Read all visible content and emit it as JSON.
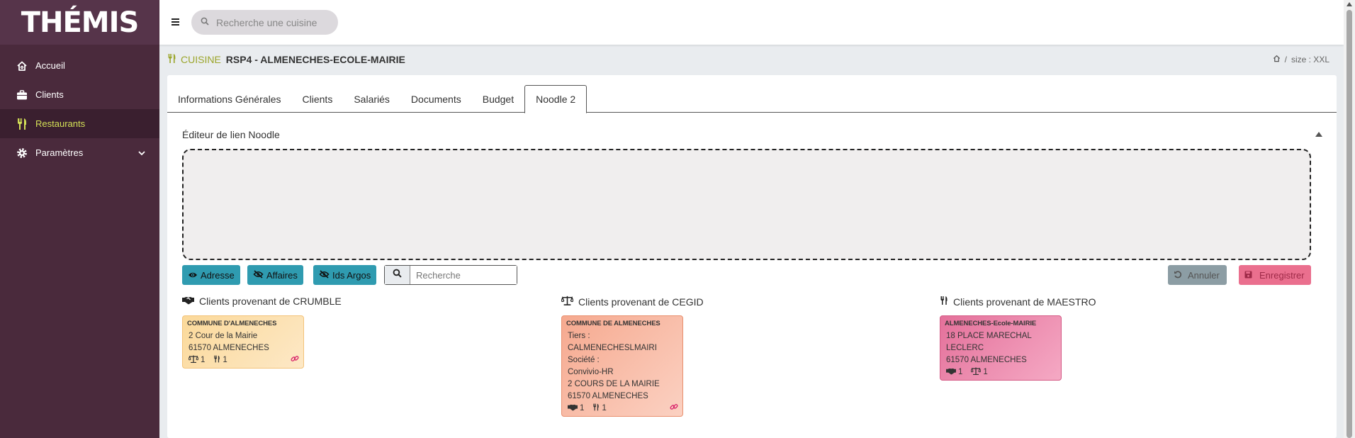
{
  "sidebar": {
    "logo": "THÉMIS",
    "items": [
      {
        "label": "Accueil",
        "icon": "home-icon"
      },
      {
        "label": "Clients",
        "icon": "briefcase-icon"
      },
      {
        "label": "Restaurants",
        "icon": "utensils-icon",
        "active": true
      },
      {
        "label": "Paramètres",
        "icon": "gear-icon"
      }
    ]
  },
  "topbar": {
    "search_placeholder": "Recherche une cuisine"
  },
  "header": {
    "kind": "CUISINE",
    "name": "RSP4 - ALMENECHES-ECOLE-MAIRIE",
    "breadcrumb_sep": "/",
    "size": "size : XXL"
  },
  "tabs": [
    {
      "label": "Informations Générales"
    },
    {
      "label": "Clients"
    },
    {
      "label": "Salariés"
    },
    {
      "label": "Documents"
    },
    {
      "label": "Budget"
    },
    {
      "label": "Noodle 2",
      "active": true
    }
  ],
  "editor": {
    "title": "Éditeur de lien Noodle"
  },
  "toolbar": {
    "adresse": "Adresse",
    "affaires": "Affaires",
    "ids_argos": "Ids Argos",
    "search_placeholder": "Recherche",
    "annuler": "Annuler",
    "enregistrer": "Enregistrer"
  },
  "columns": [
    {
      "title": "Clients provenant de CRUMBLE",
      "card": {
        "name": "COMMUNE D'ALMENECHES",
        "lines": [
          "2 Cour de la Mairie",
          "61570 ALMENECHES"
        ],
        "stat1": "1",
        "stat2": "1"
      }
    },
    {
      "title": "Clients provenant de CEGID",
      "card": {
        "name": "COMMUNE DE ALMENECHES",
        "lines": [
          "Tiers :",
          "CALMENECHESLMAIRI",
          "Société :",
          "Convivio-HR",
          "2 COURS DE LA MAIRIE",
          "61570 ALMENECHES"
        ],
        "stat1": "1",
        "stat2": "1"
      }
    },
    {
      "title": "Clients provenant de MAESTRO",
      "card": {
        "name": "ALMENECHES-Ecole-MAIRIE",
        "lines": [
          "18 PLACE MARECHAL",
          "LECLERC",
          "61570 ALMENECHES"
        ],
        "stat1": "1",
        "stat2": "1"
      }
    }
  ],
  "colors": {
    "sidebar": "#4a2a3c",
    "active_accent": "#d4e157",
    "teal": "#2f9bb0",
    "pink": "#ea6f8e"
  }
}
